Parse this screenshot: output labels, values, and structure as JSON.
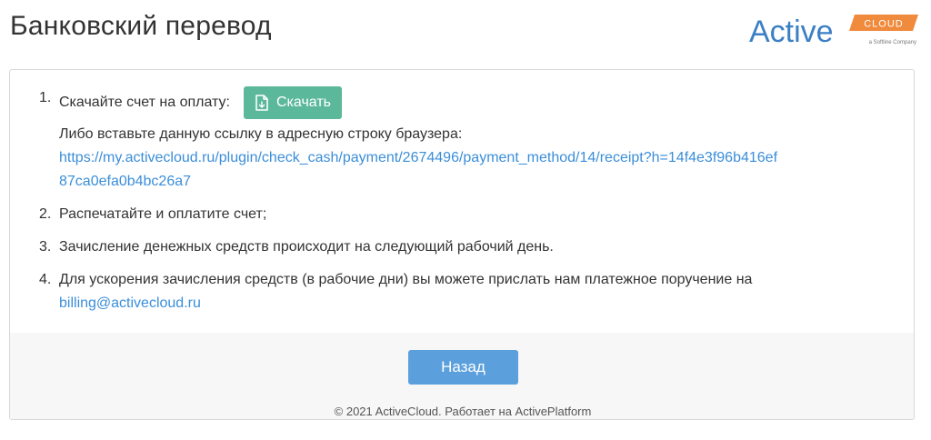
{
  "header": {
    "title": "Банковский перевод",
    "logo": {
      "word": "Active",
      "badge": "CLOUD",
      "tagline": "a Softline Company",
      "color": "#3b7fc4",
      "badge_color": "#f08a3c"
    }
  },
  "steps": [
    {
      "number": "1.",
      "label": "Скачайте счет на оплату:",
      "download_label": "Скачать",
      "sub_text": "Либо вставьте данную ссылку в адресную строку браузера:",
      "link": "https://my.activecloud.ru/plugin/check_cash/payment/2674496/payment_method/14/receipt?h=14f4e3f96b416ef87ca0efa0b4bc26a7"
    },
    {
      "number": "2.",
      "label": "Распечатайте и оплатите счет;"
    },
    {
      "number": "3.",
      "label": "Зачисление денежных средств происходит на следующий рабочий день."
    },
    {
      "number": "4.",
      "label": "Для ускорения зачисления средств (в рабочие дни) вы можете прислать нам платежное поручение на",
      "email": "billing@activecloud.ru"
    }
  ],
  "footer": {
    "back_label": "Назад",
    "copyright": "© 2021 ActiveCloud. Работает на ActivePlatform"
  },
  "colors": {
    "download_button": "#5cb89a",
    "back_button": "#5b9fdd",
    "link": "#3b8ed9"
  }
}
